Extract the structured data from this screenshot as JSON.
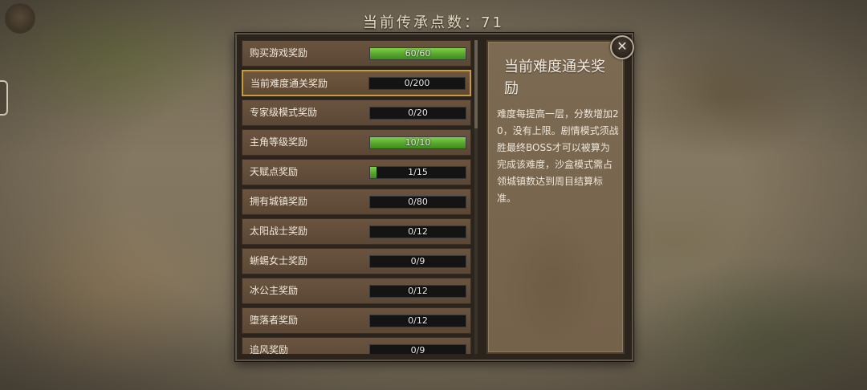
{
  "header": {
    "title": "当前传承点数：71"
  },
  "rewards": [
    {
      "label": "购买游戏奖励",
      "progress_text": "60/60",
      "progress": 1.0
    },
    {
      "label": "当前难度通关奖励",
      "progress_text": "0/200",
      "progress": 0.0,
      "selected": true
    },
    {
      "label": "专家级模式奖励",
      "progress_text": "0/20",
      "progress": 0.0
    },
    {
      "label": "主角等级奖励",
      "progress_text": "10/10",
      "progress": 1.0
    },
    {
      "label": "天赋点奖励",
      "progress_text": "1/15",
      "progress": 0.067
    },
    {
      "label": "拥有城镇奖励",
      "progress_text": "0/80",
      "progress": 0.0
    },
    {
      "label": "太阳战士奖励",
      "progress_text": "0/12",
      "progress": 0.0
    },
    {
      "label": "蜥蜴女士奖励",
      "progress_text": "0/9",
      "progress": 0.0
    },
    {
      "label": "冰公主奖励",
      "progress_text": "0/12",
      "progress": 0.0
    },
    {
      "label": "堕落者奖励",
      "progress_text": "0/12",
      "progress": 0.0
    },
    {
      "label": "追风奖励",
      "progress_text": "0/9",
      "progress": 0.0
    }
  ],
  "detail": {
    "title": "当前难度通关奖励",
    "description": "难度每提高一层，分数增加20，没有上限。剧情模式须战胜最终BOSS才可以被算为完成该难度，沙盒模式需占领城镇数达到周目结算标准。"
  },
  "close": {
    "icon": "close-icon",
    "glyph": "✕"
  },
  "colors": {
    "progress_green": "#56a52c",
    "selected_border": "#c79a3a"
  }
}
